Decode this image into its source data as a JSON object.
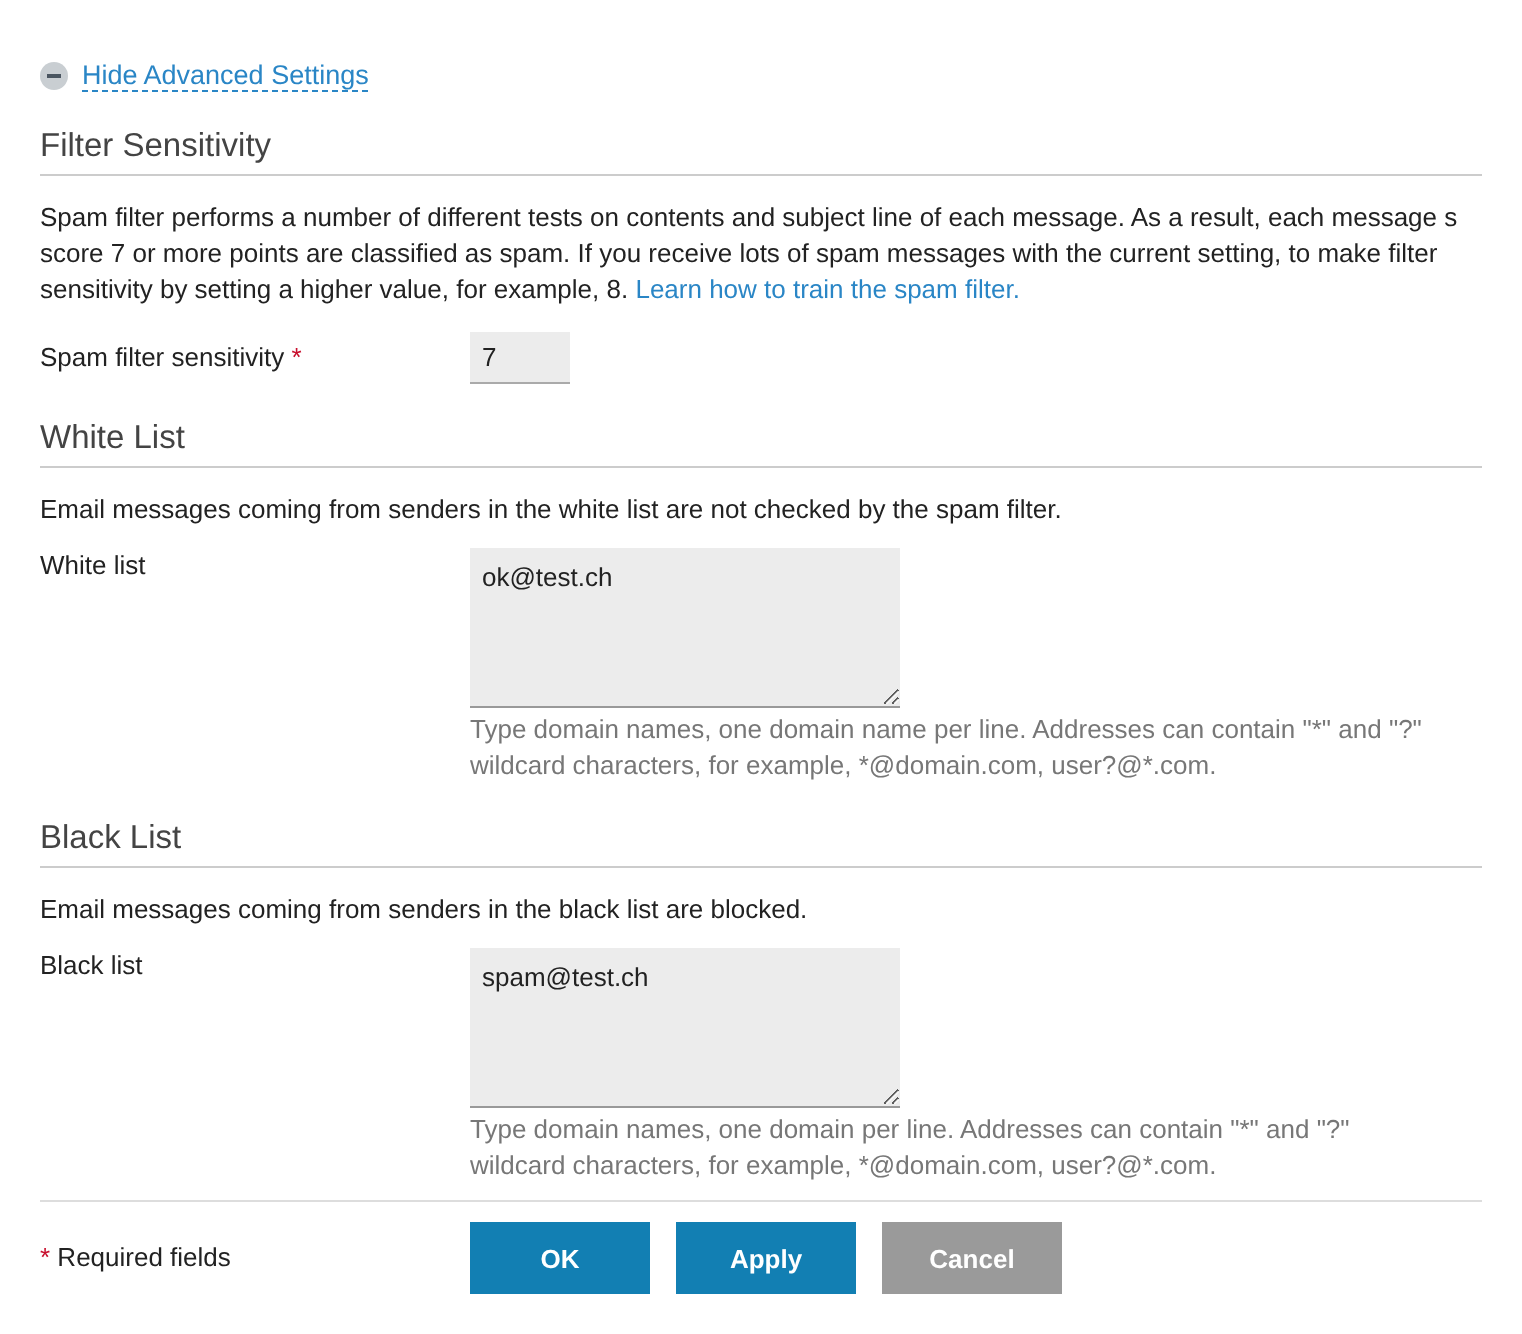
{
  "toggle": {
    "label": "Hide Advanced Settings",
    "expanded": true
  },
  "filter_sensitivity": {
    "title": "Filter Sensitivity",
    "description_lines": [
      "Spam filter performs a number of different tests on contents and subject line of each message. As a result, each message s",
      "score 7 or more points are classified as spam. If you receive lots of spam messages with the current setting, to make filter",
      "sensitivity by setting a higher value, for example, 8."
    ],
    "link": "Learn how to train the spam filter.",
    "field": {
      "label": "Spam filter sensitivity",
      "required_mark": "*",
      "value": "7"
    }
  },
  "white_list": {
    "title": "White List",
    "description": "Email messages coming from senders in the white list are not checked by the spam filter.",
    "field": {
      "label": "White list",
      "value": "ok@test.ch",
      "hint": "Type domain names, one domain name per line. Addresses can contain \"*\" and \"?\" wildcard characters, for example, *@domain.com, user?@*.com."
    }
  },
  "black_list": {
    "title": "Black List",
    "description": "Email messages coming from senders in the black list are blocked.",
    "field": {
      "label": "Black list",
      "value": "spam@test.ch",
      "hint": "Type domain names, one domain per line. Addresses can contain \"*\" and \"?\" wildcard characters, for example, *@domain.com, user?@*.com."
    }
  },
  "footer": {
    "required_mark": "*",
    "required_note": "Required fields",
    "buttons": [
      {
        "label": "OK",
        "kind": "primary"
      },
      {
        "label": "Apply",
        "kind": "primary"
      },
      {
        "label": "Cancel",
        "kind": "secondary"
      }
    ]
  }
}
